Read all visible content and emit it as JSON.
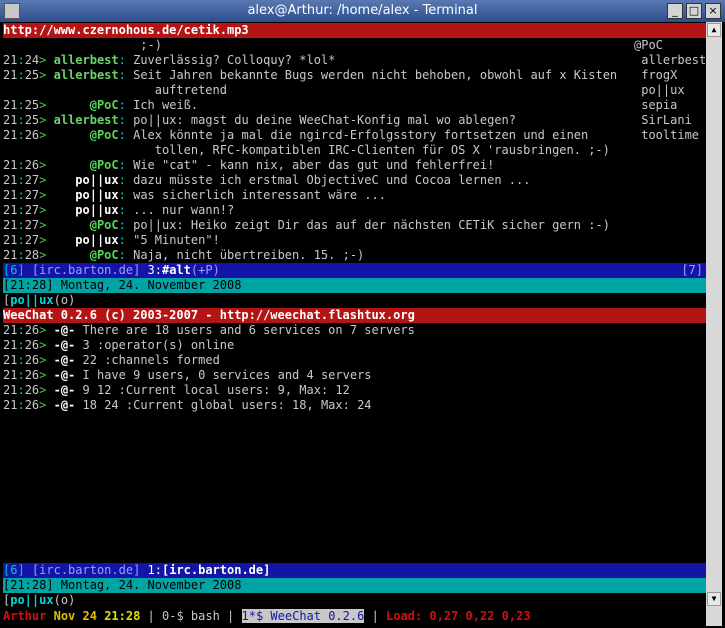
{
  "window": {
    "title": "alex@Arthur: /home/alex - Terminal"
  },
  "top": {
    "topic": "http://www.czernohous.de/cetik.mp3",
    "continuation": ";-)",
    "lines": [
      {
        "time_h": "21",
        "time_m": "24",
        "nick": "allerbest",
        "kind": "g",
        "msg": "Zuverlässig? Colloquy? *lol*"
      },
      {
        "time_h": "21",
        "time_m": "25",
        "nick": "allerbest",
        "kind": "g",
        "msg": "Seit Jahren bekannte Bugs werden nicht behoben, obwohl auf x Kisten"
      },
      {
        "time_h": "",
        "time_m": "",
        "nick": "",
        "kind": "c",
        "msg": "auftretend"
      },
      {
        "time_h": "21",
        "time_m": "25",
        "nick": "@PoC",
        "kind": "p",
        "msg": "Ich weiß."
      },
      {
        "time_h": "21",
        "time_m": "25",
        "nick": "allerbest",
        "kind": "g",
        "msg": "po||ux: magst du deine WeeChat-Konfig mal wo ablegen?"
      },
      {
        "time_h": "21",
        "time_m": "26",
        "nick": "@PoC",
        "kind": "p",
        "msg": "Alex könnte ja mal die ngircd-Erfolgsstory fortsetzen und einen"
      },
      {
        "time_h": "",
        "time_m": "",
        "nick": "",
        "kind": "c",
        "msg": "tollen, RFC-kompatiblen IRC-Clienten für OS X 'rausbringen. ;-)"
      },
      {
        "time_h": "21",
        "time_m": "26",
        "nick": "@PoC",
        "kind": "p",
        "msg": "Wie \"cat\" - kann nix, aber das gut und fehlerfrei!"
      },
      {
        "time_h": "21",
        "time_m": "27",
        "nick": "po||ux",
        "kind": "w",
        "msg": "dazu müsste ich erstmal ObjectiveC und Cocoa lernen ..."
      },
      {
        "time_h": "21",
        "time_m": "27",
        "nick": "po||ux",
        "kind": "w",
        "msg": "was sicherlich interessant wäre ..."
      },
      {
        "time_h": "21",
        "time_m": "27",
        "nick": "po||ux",
        "kind": "w",
        "msg": "... nur wann!?"
      },
      {
        "time_h": "21",
        "time_m": "27",
        "nick": "@PoC",
        "kind": "p",
        "msg": "po||ux: Heiko zeigt Dir das auf der nächsten CETiK sicher gern :-)"
      },
      {
        "time_h": "21",
        "time_m": "27",
        "nick": "po||ux",
        "kind": "w",
        "msg": "\"5 Minuten\"!"
      },
      {
        "time_h": "21",
        "time_m": "28",
        "nick": "@PoC",
        "kind": "p",
        "msg": "Naja, nicht übertreiben. 15. ;-)"
      }
    ],
    "nicklist": [
      "@PoC",
      " allerbest",
      " frogX",
      " po||ux",
      " sepia",
      " SirLani",
      " tooltime"
    ],
    "status": {
      "num": "[6]",
      "server": "[irc.barton.de]",
      "win": "3:",
      "chan": "#alt",
      "mode": "(+P)",
      "right": "[7]"
    },
    "infobar": "[21:28] Montag, 24. November 2008",
    "input": {
      "nick": "po||ux",
      "mode": "o"
    }
  },
  "bottom": {
    "topic": "WeeChat 0.2.6 (c) 2003-2007 - http://weechat.flashtux.org",
    "lines": [
      {
        "time_h": "21",
        "time_m": "26",
        "msg": "There are 18 users and 6 services on 7 servers"
      },
      {
        "time_h": "21",
        "time_m": "26",
        "msg": "3 :operator(s) online"
      },
      {
        "time_h": "21",
        "time_m": "26",
        "msg": "22 :channels formed"
      },
      {
        "time_h": "21",
        "time_m": "26",
        "msg": "I have 9 users, 0 services and 4 servers"
      },
      {
        "time_h": "21",
        "time_m": "26",
        "msg": "9 12 :Current local users: 9, Max: 12"
      },
      {
        "time_h": "21",
        "time_m": "26",
        "msg": "18 24 :Current global users: 18, Max: 24"
      }
    ],
    "prefix": "-@-",
    "status": {
      "num": "[6]",
      "server": "[irc.barton.de]",
      "win": "1:",
      "chan": "[irc.barton.de]"
    },
    "infobar": "[21:28] Montag, 24. November 2008",
    "input": {
      "nick": "po||ux",
      "mode": "o"
    }
  },
  "tmux": {
    "host": "Arthur",
    "date": "Nov 24",
    "time": "21:28",
    "w0": "0-$ bash",
    "w1": "1*$ WeeChat 0.2.6",
    "load": "Load: 0,27 0,22 0,23"
  },
  "colors": {
    "topic_bg": "#b41414",
    "status_bg": "#1414a8",
    "info_bg": "#00a4a4"
  }
}
